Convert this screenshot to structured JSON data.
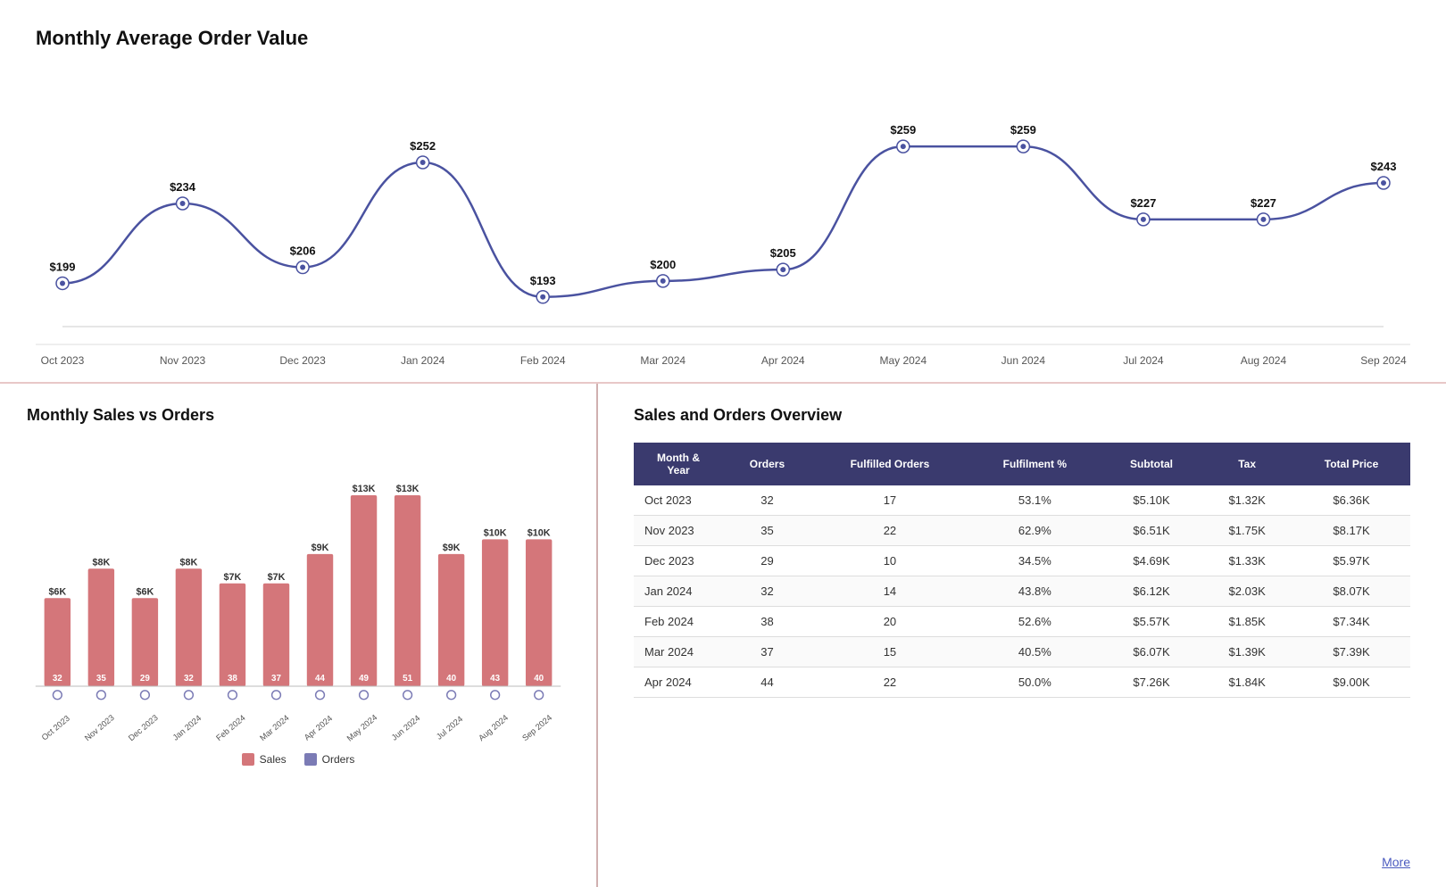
{
  "topChart": {
    "title": "Monthly Average Order Value",
    "data": [
      {
        "month": "Oct 2023",
        "value": 199
      },
      {
        "month": "Nov 2023",
        "value": 234
      },
      {
        "month": "Dec 2023",
        "value": 206
      },
      {
        "month": "Jan 2024",
        "value": 252
      },
      {
        "month": "Feb 2024",
        "value": 193
      },
      {
        "month": "Mar 2024",
        "value": 200
      },
      {
        "month": "Apr 2024",
        "value": 205
      },
      {
        "month": "May 2024",
        "value": 259
      },
      {
        "month": "Jun 2024",
        "value": 259
      },
      {
        "month": "Jul 2024",
        "value": 227
      },
      {
        "month": "Aug 2024",
        "value": 227
      },
      {
        "month": "Sep 2024",
        "value": 243
      }
    ]
  },
  "barChart": {
    "title": "Monthly Sales vs Orders",
    "data": [
      {
        "month": "Oct 2023",
        "sales": 6,
        "orders": 32
      },
      {
        "month": "Nov 2023",
        "sales": 8,
        "orders": 35
      },
      {
        "month": "Dec 2023",
        "sales": 6,
        "orders": 29
      },
      {
        "month": "Jan 2024",
        "sales": 8,
        "orders": 32
      },
      {
        "month": "Feb 2024",
        "sales": 7,
        "orders": 38
      },
      {
        "month": "Mar 2024",
        "sales": 7,
        "orders": 37
      },
      {
        "month": "Apr 2024",
        "sales": 9,
        "orders": 44
      },
      {
        "month": "May 2024",
        "sales": 13,
        "orders": 49
      },
      {
        "month": "Jun 2024",
        "sales": 13,
        "orders": 51
      },
      {
        "month": "Jul 2024",
        "sales": 9,
        "orders": 40
      },
      {
        "month": "Aug 2024",
        "sales": 10,
        "orders": 43
      },
      {
        "month": "Sep 2024",
        "sales": 10,
        "orders": 40
      }
    ],
    "legend": {
      "sales": "Sales",
      "orders": "Orders"
    },
    "salesColor": "#d4767a",
    "ordersColor": "#7b7bb5"
  },
  "table": {
    "title": "Sales and Orders Overview",
    "headers": [
      "Month & Year",
      "Orders",
      "Fulfilled Orders",
      "Fulfilment %",
      "Subtotal",
      "Tax",
      "Total Price"
    ],
    "rows": [
      {
        "month": "Oct 2023",
        "orders": 32,
        "fulfilled": 17,
        "pct": "53.1%",
        "subtotal": "$5.10K",
        "tax": "$1.32K",
        "total": "$6.36K"
      },
      {
        "month": "Nov 2023",
        "orders": 35,
        "fulfilled": 22,
        "pct": "62.9%",
        "subtotal": "$6.51K",
        "tax": "$1.75K",
        "total": "$8.17K"
      },
      {
        "month": "Dec 2023",
        "orders": 29,
        "fulfilled": 10,
        "pct": "34.5%",
        "subtotal": "$4.69K",
        "tax": "$1.33K",
        "total": "$5.97K"
      },
      {
        "month": "Jan 2024",
        "orders": 32,
        "fulfilled": 14,
        "pct": "43.8%",
        "subtotal": "$6.12K",
        "tax": "$2.03K",
        "total": "$8.07K"
      },
      {
        "month": "Feb 2024",
        "orders": 38,
        "fulfilled": 20,
        "pct": "52.6%",
        "subtotal": "$5.57K",
        "tax": "$1.85K",
        "total": "$7.34K"
      },
      {
        "month": "Mar 2024",
        "orders": 37,
        "fulfilled": 15,
        "pct": "40.5%",
        "subtotal": "$6.07K",
        "tax": "$1.39K",
        "total": "$7.39K"
      },
      {
        "month": "Apr 2024",
        "orders": 44,
        "fulfilled": 22,
        "pct": "50.0%",
        "subtotal": "$7.26K",
        "tax": "$1.84K",
        "total": "$9.00K"
      }
    ]
  },
  "footer": {
    "more_label": "More"
  }
}
